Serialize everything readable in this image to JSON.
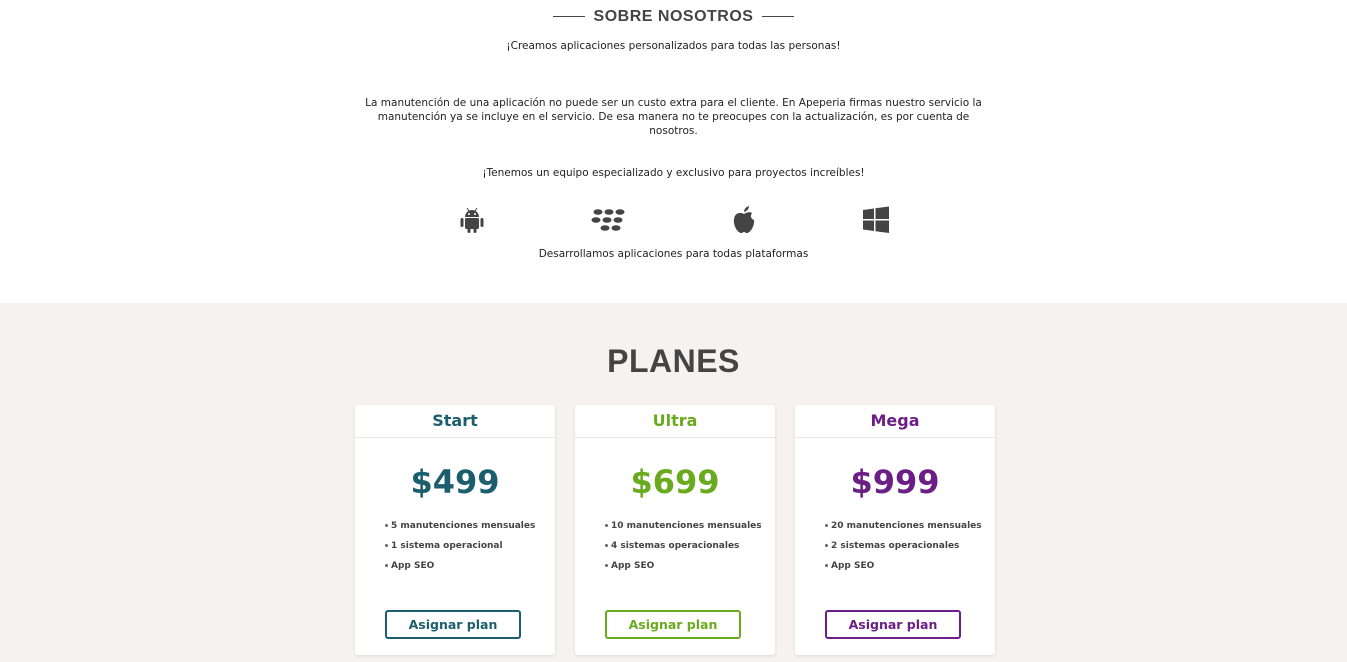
{
  "about": {
    "title": "SOBRE NOSOTROS",
    "tagline": "¡Creamos aplicaciones personalizados para todas las personas!",
    "paragraph": "La manutención de una aplicación no puede ser un custo extra para el cliente. En Apeperia firmas nuestro servicio la manutención ya se incluye en el servicio. De esa manera no te preocupes con la actualización, es por cuenta de nosotros.",
    "team": "¡Tenemos un equipo especializado y exclusivo para proyectos increíbles!",
    "platforms_text": "Desarrollamos aplicaciones para todas plataformas",
    "platform_icons": [
      "android-icon",
      "blackberry-icon",
      "apple-icon",
      "windows-icon"
    ]
  },
  "plans": {
    "title": "PLANES",
    "cards": [
      {
        "name": "Start",
        "price": "$499",
        "color": "#1b5e6e",
        "features": [
          "5 manutenciones mensuales",
          "1 sistema operacional",
          "App SEO"
        ],
        "button": "Asignar plan"
      },
      {
        "name": "Ultra",
        "price": "$699",
        "color": "#6aaa1e",
        "features": [
          "10 manutenciones mensuales",
          "4 sistemas operacionales",
          "App SEO"
        ],
        "button": "Asignar plan"
      },
      {
        "name": "Mega",
        "price": "$999",
        "color": "#6b1f86",
        "features": [
          "20 manutenciones mensuales",
          "2 sistemas operacionales",
          "App SEO"
        ],
        "button": "Asignar plan"
      }
    ]
  }
}
